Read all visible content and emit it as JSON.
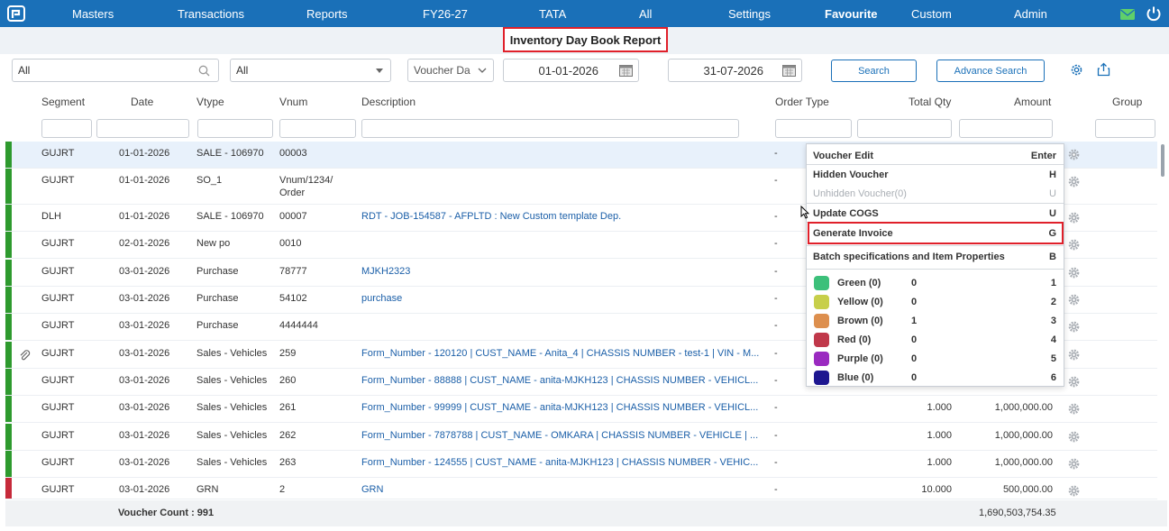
{
  "nav": {
    "items": [
      "Masters",
      "Transactions",
      "Reports",
      "FY26-27",
      "TATA",
      "All",
      "Settings",
      "Favourite",
      "Custom",
      "Admin"
    ]
  },
  "report_title": "Inventory Day Book Report",
  "filters": {
    "search_value": "All",
    "type_select": "All",
    "date_type": "Voucher Da",
    "from_date": "01-01-2026",
    "to_date": "31-07-2026",
    "search_button": "Search",
    "advance_search_button": "Advance Search"
  },
  "columns": [
    "Segment",
    "Date",
    "Vtype",
    "Vnum",
    "Description",
    "Order Type",
    "Total Qty",
    "Amount",
    "Group"
  ],
  "rows": [
    {
      "segment": "GUJRT",
      "date": "01-01-2026",
      "vtype": "SALE - 106970",
      "vnum": "00003",
      "vnum2": "",
      "desc": "",
      "order_type": "-",
      "qty": "",
      "amount": "",
      "status_color": "#2e9a2e",
      "attachment": false
    },
    {
      "segment": "GUJRT",
      "date": "01-01-2026",
      "vtype": "SO_1",
      "vnum": "Vnum/1234/",
      "vnum2": "Order",
      "desc": "",
      "order_type": "-",
      "qty": "",
      "amount": "",
      "status_color": "#2e9a2e",
      "attachment": false
    },
    {
      "segment": "DLH",
      "date": "01-01-2026",
      "vtype": "SALE - 106970",
      "vnum": "00007",
      "vnum2": "",
      "desc": "RDT - JOB-154587 - AFPLTD : New Custom template Dep.",
      "order_type": "-",
      "qty": "",
      "amount": "",
      "status_color": "#2e9a2e",
      "attachment": false
    },
    {
      "segment": "GUJRT",
      "date": "02-01-2026",
      "vtype": "New po",
      "vnum": "0010",
      "vnum2": "",
      "desc": "",
      "order_type": "-",
      "qty": "",
      "amount": "",
      "status_color": "#2e9a2e",
      "attachment": false
    },
    {
      "segment": "GUJRT",
      "date": "03-01-2026",
      "vtype": "Purchase",
      "vnum": "78777",
      "vnum2": "",
      "desc": "MJKH2323",
      "order_type": "-",
      "qty": "",
      "amount": "",
      "status_color": "#2e9a2e",
      "attachment": false
    },
    {
      "segment": "GUJRT",
      "date": "03-01-2026",
      "vtype": "Purchase",
      "vnum": "54102",
      "vnum2": "",
      "desc": "purchase",
      "order_type": "-",
      "qty": "",
      "amount": "",
      "status_color": "#2e9a2e",
      "attachment": false
    },
    {
      "segment": "GUJRT",
      "date": "03-01-2026",
      "vtype": "Purchase",
      "vnum": "4444444",
      "vnum2": "",
      "desc": "",
      "order_type": "-",
      "qty": "",
      "amount": "",
      "status_color": "#2e9a2e",
      "attachment": false
    },
    {
      "segment": "GUJRT",
      "date": "03-01-2026",
      "vtype": "Sales - Vehicles",
      "vnum": "259",
      "vnum2": "",
      "desc": "Form_Number - 120120 | CUST_NAME - Anita_4 | CHASSIS NUMBER - test-1 | VIN - M...",
      "order_type": "-",
      "qty": "",
      "amount": "",
      "status_color": "#2e9a2e",
      "attachment": true
    },
    {
      "segment": "GUJRT",
      "date": "03-01-2026",
      "vtype": "Sales - Vehicles",
      "vnum": "260",
      "vnum2": "",
      "desc": "Form_Number - 88888 | CUST_NAME - anita-MJKH123 | CHASSIS NUMBER - VEHICL...",
      "order_type": "-",
      "qty": "",
      "amount": "",
      "status_color": "#2e9a2e",
      "attachment": false
    },
    {
      "segment": "GUJRT",
      "date": "03-01-2026",
      "vtype": "Sales - Vehicles",
      "vnum": "261",
      "vnum2": "",
      "desc": "Form_Number - 99999 | CUST_NAME - anita-MJKH123 | CHASSIS NUMBER - VEHICL...",
      "order_type": "-",
      "qty": "1.000",
      "amount": "1,000,000.00",
      "status_color": "#2e9a2e",
      "attachment": false
    },
    {
      "segment": "GUJRT",
      "date": "03-01-2026",
      "vtype": "Sales - Vehicles",
      "vnum": "262",
      "vnum2": "",
      "desc": "Form_Number - 7878788 | CUST_NAME - OMKARA | CHASSIS NUMBER - VEHICLE | ...",
      "order_type": "-",
      "qty": "1.000",
      "amount": "1,000,000.00",
      "status_color": "#2e9a2e",
      "attachment": false
    },
    {
      "segment": "GUJRT",
      "date": "03-01-2026",
      "vtype": "Sales - Vehicles",
      "vnum": "263",
      "vnum2": "",
      "desc": "Form_Number - 124555 | CUST_NAME - anita-MJKH123 | CHASSIS NUMBER - VEHIC...",
      "order_type": "-",
      "qty": "1.000",
      "amount": "1,000,000.00",
      "status_color": "#2e9a2e",
      "attachment": false
    },
    {
      "segment": "GUJRT",
      "date": "03-01-2026",
      "vtype": "GRN",
      "vnum": "2",
      "vnum2": "",
      "desc": "GRN",
      "order_type": "-",
      "qty": "10.000",
      "amount": "500,000.00",
      "status_color": "#c62a3a",
      "attachment": false
    }
  ],
  "footer": {
    "voucher_count": "Voucher Count : 991",
    "total_amount": "1,690,503,754.35"
  },
  "context_menu": {
    "items": [
      {
        "label": "Voucher Edit",
        "key": "Enter",
        "disabled": false
      },
      {
        "label": "Hidden Voucher",
        "key": "H",
        "disabled": false
      },
      {
        "label": "Unhidden Voucher(0)",
        "key": "U",
        "disabled": true
      },
      {
        "label": "Update COGS",
        "key": "U",
        "disabled": false
      },
      {
        "label": "Generate Invoice",
        "key": "G",
        "disabled": false
      },
      {
        "label": "Batch specifications and Item Properties",
        "key": "B",
        "disabled": false
      }
    ],
    "colors": [
      {
        "name": "Green (0)",
        "count": "0",
        "key": "1",
        "color": "#3cc07a"
      },
      {
        "name": "Yellow (0)",
        "count": "0",
        "key": "2",
        "color": "#c7cf4a"
      },
      {
        "name": "Brown (0)",
        "count": "1",
        "key": "3",
        "color": "#dd8f4e"
      },
      {
        "name": "Red (0)",
        "count": "0",
        "key": "4",
        "color": "#c0384a"
      },
      {
        "name": "Purple (0)",
        "count": "0",
        "key": "5",
        "color": "#9a2ac0"
      },
      {
        "name": "Blue (0)",
        "count": "0",
        "key": "6",
        "color": "#1d1690"
      }
    ]
  },
  "colors": {
    "nav_bg": "#1a70b8",
    "highlight": "#e0202a",
    "link": "#1b5fa8"
  }
}
